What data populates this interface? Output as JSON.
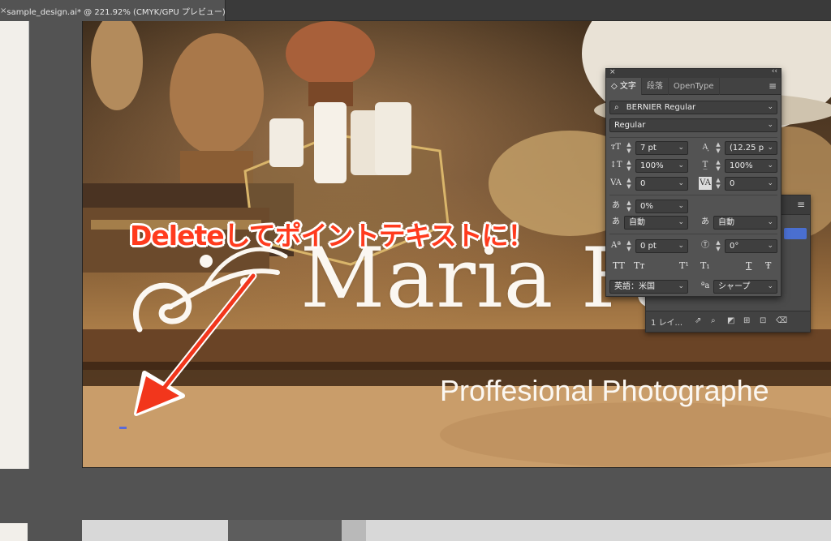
{
  "document_tab": {
    "close_glyph": "×",
    "title": "sample_design.ai* @ 221.92% (CMYK/GPU プレビュー)"
  },
  "artwork": {
    "title": "Maria Fa",
    "subtitle": "Proffesional Photographe"
  },
  "annotation": {
    "text": "Deleteしてポイントテキストに！",
    "color": "#ff3b1e"
  },
  "character_panel": {
    "close_glyph": "×",
    "collapse_glyph": "‹‹",
    "menu_glyph": "≡",
    "tabs": [
      {
        "label": "◇ 文字",
        "active": true
      },
      {
        "label": "段落",
        "active": false
      },
      {
        "label": "OpenType",
        "active": false
      }
    ],
    "font_family": "BERNIER Regular",
    "font_style": "Regular",
    "font_size": "7 pt",
    "leading": "(12.25 p",
    "vertical_scale": "100%",
    "horizontal_scale": "100%",
    "kerning": "0",
    "tracking": "0",
    "tsume": "0%",
    "aki_left": "自動",
    "aki_right": "自動",
    "baseline_shift": "0 pt",
    "rotation": "0°",
    "language": "英語：米国",
    "antialias_prefix": "ªa",
    "antialias": "シャープ",
    "typo_buttons": [
      "TT",
      "Tт",
      "T¹",
      "T₁",
      "T",
      "Ŧ"
    ]
  },
  "layers_panel": {
    "menu_glyph": "≡",
    "layer_count": "1 レイ...",
    "accent": "#4a6fd0"
  }
}
